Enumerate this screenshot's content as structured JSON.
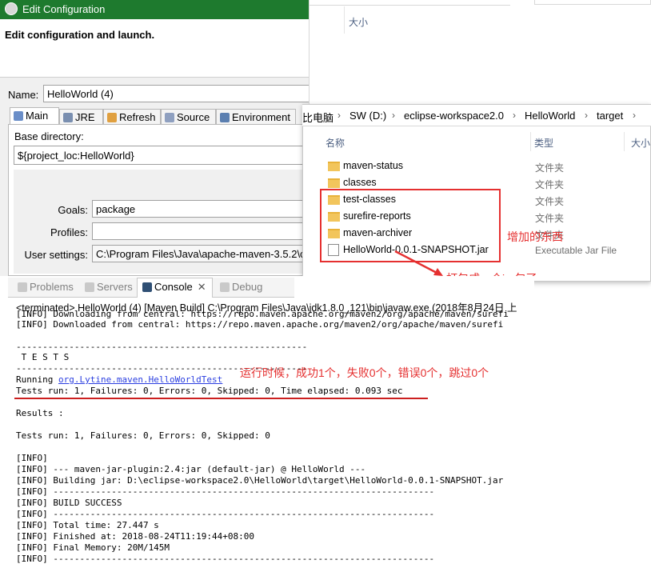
{
  "dialog": {
    "title": "Edit Configuration",
    "header": "Edit configuration and launch.",
    "name_label": "Name:",
    "name_value": "HelloWorld (4)",
    "tabs": [
      "Main",
      "JRE",
      "Refresh",
      "Source",
      "Environment"
    ],
    "base_dir_label": "Base directory:",
    "base_dir_value": "${project_loc:HelloWorld}",
    "goals_label": "Goals:",
    "goals_value": "package",
    "profiles_label": "Profiles:",
    "profiles_value": "",
    "user_settings_label": "User settings:",
    "user_settings_value": "C:\\Program Files\\Java\\apache-maven-3.5.2\\c"
  },
  "explorer_top": {
    "column": "大小"
  },
  "explorer": {
    "breadcrumb": [
      "比电脑",
      "SW (D:)",
      "eclipse-workspace2.0",
      "HelloWorld",
      "target"
    ],
    "columns": [
      "名称",
      "类型",
      "大小"
    ],
    "files": [
      {
        "name": "maven-status",
        "type": "文件夹",
        "kind": "folder"
      },
      {
        "name": "classes",
        "type": "文件夹",
        "kind": "folder"
      },
      {
        "name": "test-classes",
        "type": "文件夹",
        "kind": "folder"
      },
      {
        "name": "surefire-reports",
        "type": "文件夹",
        "kind": "folder"
      },
      {
        "name": "maven-archiver",
        "type": "文件夹",
        "kind": "folder"
      },
      {
        "name": "HelloWorld-0.0.1-SNAPSHOT.jar",
        "type": "Executable Jar File",
        "kind": "jar"
      }
    ],
    "note_added": "增加的东西",
    "note_jar": "打包成一个jar包了"
  },
  "console": {
    "tabs": [
      "Problems",
      "Servers",
      "Console",
      "Debug"
    ],
    "terminated": "<terminated> HelloWorld (4) [Maven Build] C:\\Program Files\\Java\\jdk1.8.0_121\\bin\\javaw.exe (2018年8月24日 上",
    "lines": [
      "[INFO] Downloading from central: https://repo.maven.apache.org/maven2/org/apache/maven/surefi",
      "[INFO] Downloaded from central: https://repo.maven.apache.org/maven2/org/apache/maven/surefi",
      "",
      "-------------------------------------------------------",
      " T E S T S",
      "-------------------------------------------------------"
    ],
    "running_prefix": "Running ",
    "running_link": "org.Lytine.maven.HelloWorldTest",
    "lines2": [
      "Tests run: 1, Failures: 0, Errors: 0, Skipped: 0, Time elapsed: 0.093 sec",
      "",
      "Results :",
      "",
      "Tests run: 1, Failures: 0, Errors: 0, Skipped: 0",
      "",
      "[INFO]",
      "[INFO] --- maven-jar-plugin:2.4:jar (default-jar) @ HelloWorld ---",
      "[INFO] Building jar: D:\\eclipse-workspace2.0\\HelloWorld\\target\\HelloWorld-0.0.1-SNAPSHOT.jar",
      "[INFO] ------------------------------------------------------------------------",
      "[INFO] BUILD SUCCESS",
      "[INFO] ------------------------------------------------------------------------",
      "[INFO] Total time: 27.447 s",
      "[INFO] Finished at: 2018-08-24T11:19:44+08:00",
      "[INFO] Final Memory: 20M/145M",
      "[INFO] ------------------------------------------------------------------------"
    ],
    "note": "运行时候，成功1个，失败0个，错误0个，跳过0个"
  },
  "colors": {
    "accent_red": "#e53030",
    "title_bar": "#1e7a2e",
    "link": "#2a3ee0"
  }
}
